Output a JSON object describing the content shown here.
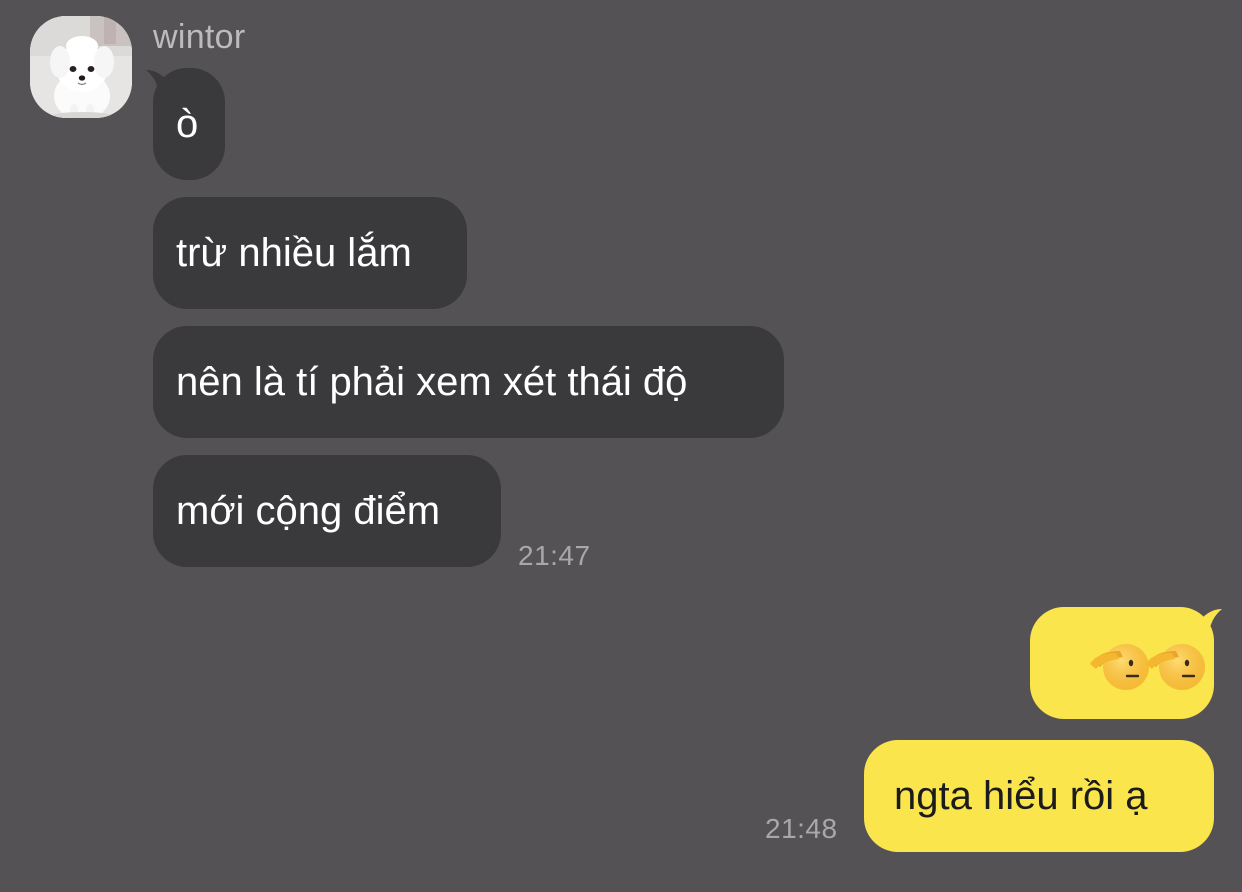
{
  "contact": {
    "name": "wintor"
  },
  "messages_in": [
    {
      "text": "ò"
    },
    {
      "text": "trừ nhiều lắm"
    },
    {
      "text": "nên là tí phải xem xét thái độ"
    },
    {
      "text": "mới cộng điểm"
    }
  ],
  "messages_in_time": "21:47",
  "messages_out": [
    {
      "emoji": [
        "saluting-face",
        "saluting-face"
      ]
    },
    {
      "text": "ngta hiểu rồi ạ"
    }
  ],
  "messages_out_time": "21:48",
  "colors": {
    "background": "#545254",
    "incoming_bubble": "#3a393b",
    "outgoing_bubble": "#fae54c",
    "sender_name": "#bdbbbd",
    "timestamp": "#a9a7aa"
  }
}
